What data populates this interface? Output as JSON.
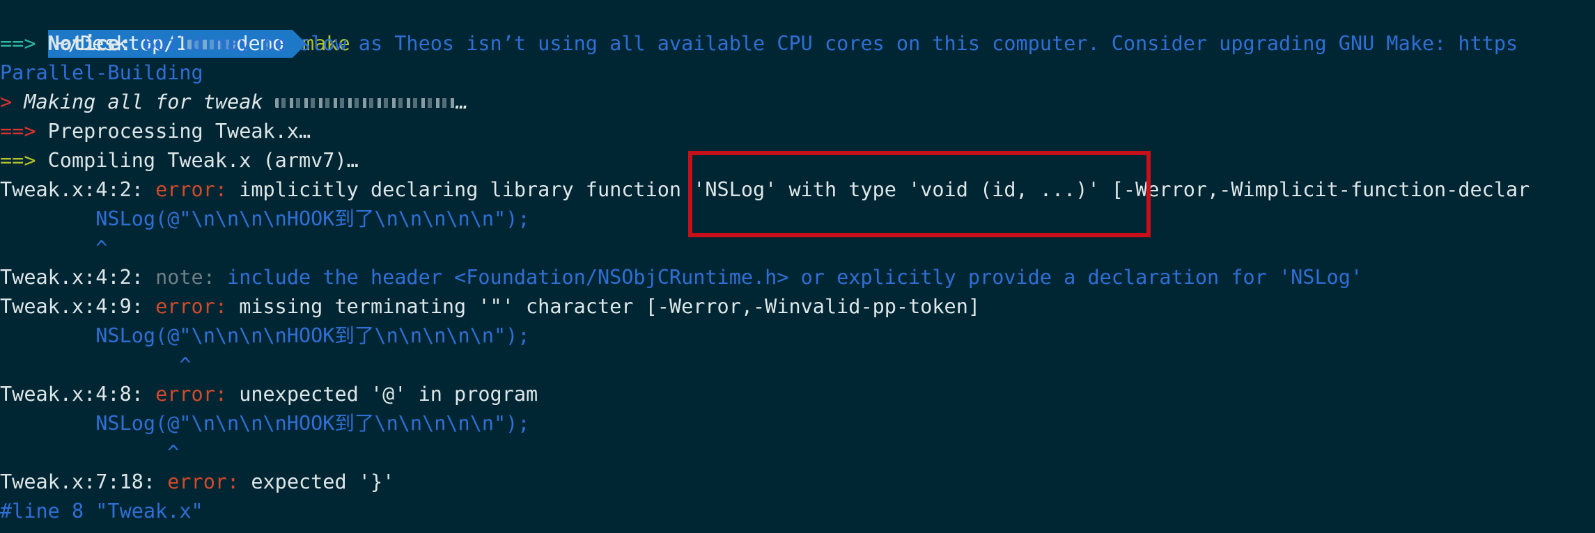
{
  "prompt": {
    "path_prefix": "~/Desktop/1",
    "path_redacted": "■■■■■",
    "path_suffix": "demo",
    "command": "make"
  },
  "lines": {
    "notice_arrow": "==>",
    "notice_label": "Notice:",
    "notice_text": "Build may be slow as Theos isn’t using all available CPU cores on this computer. Consider upgrading GNU Make: https",
    "notice_cont": "Parallel-Building",
    "making_arrow": ">",
    "making_text": "Making all for tweak",
    "making_redacted": "■■■■■■■",
    "making_ellipsis": "…",
    "preproc_arrow": "==>",
    "preproc_text": "Preprocessing Tweak.x…",
    "compiling_arrow": "==>",
    "compiling_text": "Compiling Tweak.x (armv7)…",
    "e1_loc": "Tweak.x:4:2:",
    "e1_kind": "error:",
    "e1_msg": "implicitly declaring library function 'NSLog' with type 'void (id, ...)' [-Werror,-Wimplicit-function-declar",
    "e1_src": "        NSLog(@\"\\n\\n\\n\\nHOOK到了\\n\\n\\n\\n\\n\");",
    "e1_caret": "        ^",
    "n1_loc": "Tweak.x:4:2:",
    "n1_kind": "note:",
    "n1_msg": "include the header <Foundation/NSObjCRuntime.h> or explicitly provide a declaration for 'NSLog'",
    "e2_loc": "Tweak.x:4:9:",
    "e2_kind": "error:",
    "e2_msg": "missing terminating '\"' character [-Werror,-Winvalid-pp-token]",
    "e2_src": "        NSLog(@\"\\n\\n\\n\\nHOOK到了\\n\\n\\n\\n\\n\");",
    "e2_caret": "               ^",
    "e3_loc": "Tweak.x:4:8:",
    "e3_kind": "error:",
    "e3_msg": "unexpected '@' in program",
    "e3_src": "        NSLog(@\"\\n\\n\\n\\nHOOK到了\\n\\n\\n\\n\\n\");",
    "e3_caret": "              ^",
    "e4_loc": "Tweak.x:7:18:",
    "e4_kind": "error:",
    "e4_msg": "expected '}'",
    "line_directive": "#line 8 \"Tweak.x\""
  },
  "colors": {
    "background": "#002633",
    "prompt_bg": "#1e78c8",
    "error": "#d34a2a",
    "highlight": "#c8101a"
  }
}
